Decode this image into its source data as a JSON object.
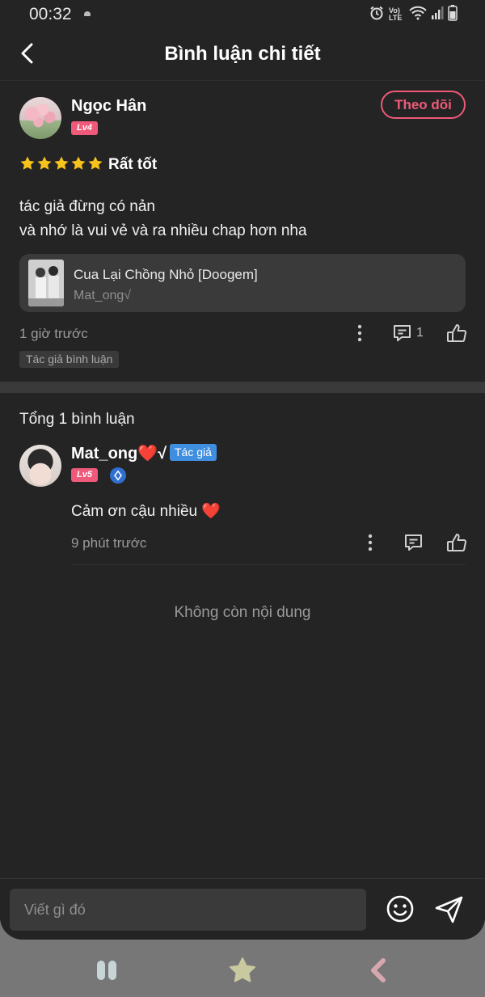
{
  "status_bar": {
    "time": "00:32",
    "network_label": "Vo) LTE"
  },
  "header": {
    "title": "Bình luận chi tiết",
    "back_icon": "chevron-left-icon"
  },
  "comment": {
    "username": "Ngọc Hân",
    "level": "Lv4",
    "follow_label": "Theo dõi",
    "rating_stars": 5,
    "rating_text": "Rất tốt",
    "text_line1": "tác giả đừng có nản",
    "text_line2": "và nhớ là vui vẻ và ra nhiều chap hơn nha",
    "book": {
      "title": "Cua Lại Chồng Nhỏ [Doogem]",
      "author": "Mat_ong√"
    },
    "time": "1 giờ trước",
    "reply_count": "1",
    "author_tag": "Tác giả bình luận"
  },
  "replies": {
    "total_text": "Tổng 1 bình luận",
    "items": [
      {
        "username": "Mat_ong❤️√",
        "author_badge": "Tác giả",
        "level": "Lv5",
        "text": "Cảm ơn cậu nhiều ❤️",
        "time": "9 phút trước"
      }
    ],
    "end_text": "Không còn nội dung"
  },
  "input": {
    "placeholder": "Viết gì đó"
  },
  "colors": {
    "accent": "#ef5a7a",
    "author_badge": "#3f8ee0",
    "star": "#f6c21c",
    "background": "#242424"
  }
}
